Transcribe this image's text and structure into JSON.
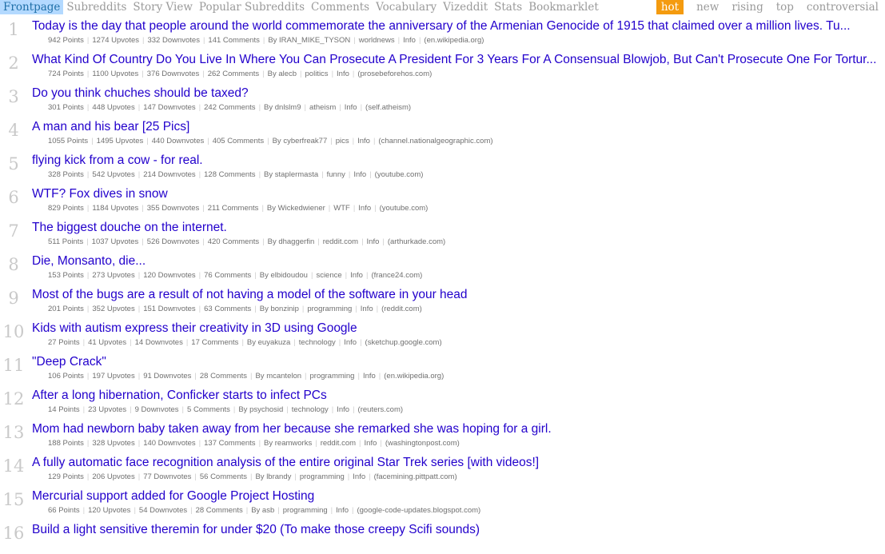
{
  "nav": {
    "left": [
      "Frontpage",
      "Subreddits",
      "Story View",
      "Popular Subreddits",
      "Comments",
      "Vocabulary",
      "Vizeddit",
      "Stats",
      "Bookmarklet"
    ],
    "right": [
      "hot",
      "new",
      "rising",
      "top",
      "controversial"
    ],
    "active_left": "Frontpage",
    "active_right": "hot"
  },
  "colors": {
    "title_link": "#2200cc",
    "active_tab": "#b3d9ff",
    "hot_tab": "#f49b0f"
  },
  "stories": [
    {
      "rank": "1",
      "title": "Today is the day that people around the world commemorate the anniversary of the Armenian Genocide of 1915 that claimed over a million lives. Tu...",
      "points": "942 Points",
      "upvotes": "1274 Upvotes",
      "downvotes": "332 Downvotes",
      "comments": "141 Comments",
      "author": "By IRAN_MIKE_TYSON",
      "subreddit": "worldnews",
      "info": "Info",
      "domain": "(en.wikipedia.org)"
    },
    {
      "rank": "2",
      "title": "What Kind Of Country Do You Live In Where You Can Prosecute A President For 3 Years For A Consensual Blowjob, But Can't Prosecute One For Tortur...",
      "points": "724 Points",
      "upvotes": "1100 Upvotes",
      "downvotes": "376 Downvotes",
      "comments": "262 Comments",
      "author": "By alecb",
      "subreddit": "politics",
      "info": "Info",
      "domain": "(prosebeforehos.com)"
    },
    {
      "rank": "3",
      "title": "Do you think chuches should be taxed?",
      "points": "301 Points",
      "upvotes": "448 Upvotes",
      "downvotes": "147 Downvotes",
      "comments": "242 Comments",
      "author": "By dnlslm9",
      "subreddit": "atheism",
      "info": "Info",
      "domain": "(self.atheism)"
    },
    {
      "rank": "4",
      "title": "A man and his bear [25 Pics]",
      "points": "1055 Points",
      "upvotes": "1495 Upvotes",
      "downvotes": "440 Downvotes",
      "comments": "405 Comments",
      "author": "By cyberfreak77",
      "subreddit": "pics",
      "info": "Info",
      "domain": "(channel.nationalgeographic.com)"
    },
    {
      "rank": "5",
      "title": "flying kick from a cow - for real.",
      "points": "328 Points",
      "upvotes": "542 Upvotes",
      "downvotes": "214 Downvotes",
      "comments": "128 Comments",
      "author": "By staplermasta",
      "subreddit": "funny",
      "info": "Info",
      "domain": "(youtube.com)"
    },
    {
      "rank": "6",
      "title": "WTF? Fox dives in snow",
      "points": "829 Points",
      "upvotes": "1184 Upvotes",
      "downvotes": "355 Downvotes",
      "comments": "211 Comments",
      "author": "By Wickedwiener",
      "subreddit": "WTF",
      "info": "Info",
      "domain": "(youtube.com)"
    },
    {
      "rank": "7",
      "title": "The biggest douche on the internet.",
      "points": "511 Points",
      "upvotes": "1037 Upvotes",
      "downvotes": "526 Downvotes",
      "comments": "420 Comments",
      "author": "By dhaggerfin",
      "subreddit": "reddit.com",
      "info": "Info",
      "domain": "(arthurkade.com)"
    },
    {
      "rank": "8",
      "title": "Die, Monsanto, die...",
      "points": "153 Points",
      "upvotes": "273 Upvotes",
      "downvotes": "120 Downvotes",
      "comments": "76 Comments",
      "author": "By elbidoudou",
      "subreddit": "science",
      "info": "Info",
      "domain": "(france24.com)"
    },
    {
      "rank": "9",
      "title": "Most of the bugs are a result of not having a model of the software in your head",
      "points": "201 Points",
      "upvotes": "352 Upvotes",
      "downvotes": "151 Downvotes",
      "comments": "63 Comments",
      "author": "By bonzinip",
      "subreddit": "programming",
      "info": "Info",
      "domain": "(reddit.com)"
    },
    {
      "rank": "10",
      "title": "Kids with autism express their creativity in 3D using Google",
      "points": "27 Points",
      "upvotes": "41 Upvotes",
      "downvotes": "14 Downvotes",
      "comments": "17 Comments",
      "author": "By euyakuza",
      "subreddit": "technology",
      "info": "Info",
      "domain": "(sketchup.google.com)"
    },
    {
      "rank": "11",
      "title": "\"Deep Crack\"",
      "points": "106 Points",
      "upvotes": "197 Upvotes",
      "downvotes": "91 Downvotes",
      "comments": "28 Comments",
      "author": "By mcantelon",
      "subreddit": "programming",
      "info": "Info",
      "domain": "(en.wikipedia.org)"
    },
    {
      "rank": "12",
      "title": "After a long hibernation, Conficker starts to infect PCs",
      "points": "14 Points",
      "upvotes": "23 Upvotes",
      "downvotes": "9 Downvotes",
      "comments": "5 Comments",
      "author": "By psychosid",
      "subreddit": "technology",
      "info": "Info",
      "domain": "(reuters.com)"
    },
    {
      "rank": "13",
      "title": "Mom had newborn baby taken away from her because she remarked she was hoping for a girl.",
      "points": "188 Points",
      "upvotes": "328 Upvotes",
      "downvotes": "140 Downvotes",
      "comments": "137 Comments",
      "author": "By reamworks",
      "subreddit": "reddit.com",
      "info": "Info",
      "domain": "(washingtonpost.com)"
    },
    {
      "rank": "14",
      "title": "A fully automatic face recognition analysis of the entire original Star Trek series [with videos!]",
      "points": "129 Points",
      "upvotes": "206 Upvotes",
      "downvotes": "77 Downvotes",
      "comments": "56 Comments",
      "author": "By lbrandy",
      "subreddit": "programming",
      "info": "Info",
      "domain": "(facemining.pittpatt.com)"
    },
    {
      "rank": "15",
      "title": "Mercurial support added for Google Project Hosting",
      "points": "66 Points",
      "upvotes": "120 Upvotes",
      "downvotes": "54 Downvotes",
      "comments": "28 Comments",
      "author": "By asb",
      "subreddit": "programming",
      "info": "Info",
      "domain": "(google-code-updates.blogspot.com)"
    },
    {
      "rank": "16",
      "title": "Build a light sensitive theremin for under $20 (To make those creepy Scifi sounds)",
      "points": "",
      "upvotes": "",
      "downvotes": "",
      "comments": "",
      "author": "",
      "subreddit": "",
      "info": "",
      "domain": ""
    }
  ]
}
